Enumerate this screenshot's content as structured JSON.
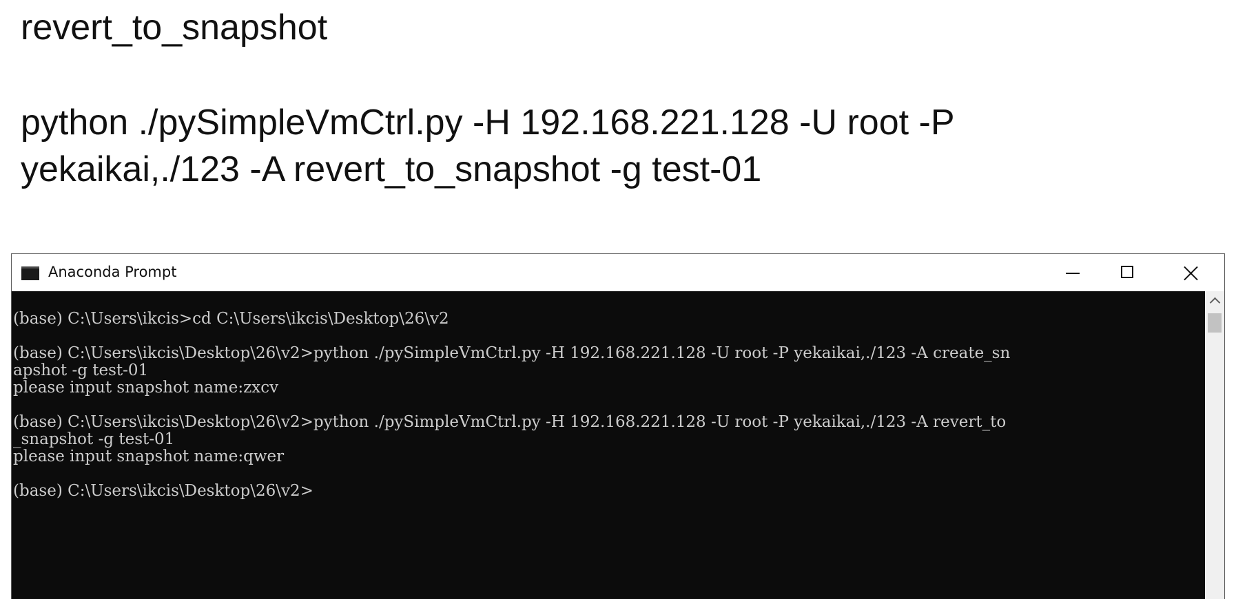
{
  "document": {
    "heading": "revert_to_snapshot",
    "command_line1": "python ./pySimpleVmCtrl.py -H 192.168.221.128 -U root -P",
    "command_line2": "yekaikai,./123 -A revert_to_snapshot -g test-01"
  },
  "window": {
    "title": "Anaconda Prompt",
    "icon": "console-icon",
    "controls": [
      "minimize-icon",
      "maximize-icon",
      "close-icon"
    ]
  },
  "console": {
    "lines": [
      "(base) C:\\Users\\ikcis>cd C:\\Users\\ikcis\\Desktop\\26\\v2",
      "(base) C:\\Users\\ikcis\\Desktop\\26\\v2>python ./pySimpleVmCtrl.py -H 192.168.221.128 -U root -P yekaikai,./123 -A create_sn",
      "apshot -g test-01",
      "please input snapshot name:zxcv",
      "(base) C:\\Users\\ikcis\\Desktop\\26\\v2>python ./pySimpleVmCtrl.py -H 192.168.221.128 -U root -P yekaikai,./123 -A revert_to",
      "_snapshot -g test-01",
      "please input snapshot name:qwer",
      "(base) C:\\Users\\ikcis\\Desktop\\26\\v2>"
    ]
  },
  "colors": {
    "console_background": "#0c0c0c",
    "console_text": "#cccccc",
    "document_text": "#111111"
  }
}
